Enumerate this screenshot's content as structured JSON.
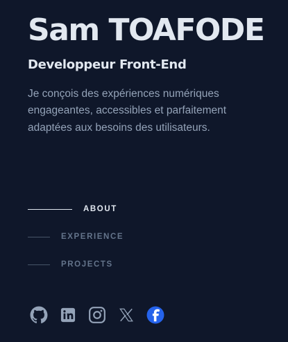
{
  "profile": {
    "name": "Sam TOAFODE",
    "role": "Developpeur Front-End",
    "bio": "Je conçois des expériences numériques engageantes, accessibles et parfaitement adaptées aux besoins des utilisateurs."
  },
  "nav": [
    {
      "label": "ABOUT",
      "active": true
    },
    {
      "label": "EXPERIENCE",
      "active": false
    },
    {
      "label": "PROJECTS",
      "active": false
    }
  ],
  "socials": [
    {
      "icon": "github-icon"
    },
    {
      "icon": "linkedin-icon"
    },
    {
      "icon": "instagram-icon"
    },
    {
      "icon": "x-icon"
    },
    {
      "icon": "freecodecamp-icon"
    }
  ],
  "colors": {
    "background": "#0f172a",
    "heading": "#e2e8f0",
    "muted": "#94a3b8",
    "nav_inactive": "#64748b",
    "brand_blue": "#2563eb"
  }
}
